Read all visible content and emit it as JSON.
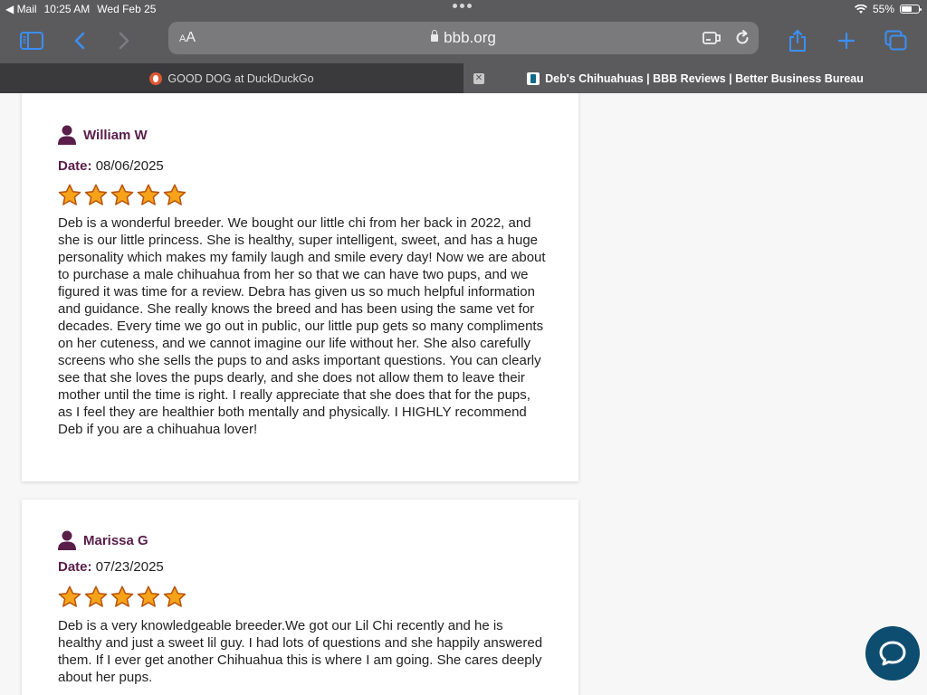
{
  "status_bar": {
    "back_app": "Mail",
    "time": "10:25 AM",
    "date": "Wed Feb 25",
    "battery": "55%",
    "battery_level": 0.55
  },
  "toolbar": {
    "text_size_label_small": "A",
    "text_size_label_large": "A",
    "url_domain": "bbb.org"
  },
  "tabs": [
    {
      "label": "GOOD DOG at DuckDuckGo",
      "active": false,
      "favicon": "duckduckgo-icon"
    },
    {
      "label": "Deb's Chihuahuas | BBB Reviews | Better Business Bureau",
      "active": true,
      "favicon": "bbb-icon"
    }
  ],
  "reviews": [
    {
      "name": "William W",
      "date_label": "Date:",
      "date": "08/06/2025",
      "rating": 5,
      "text": "Deb is a wonderful breeder. We bought our little chi from her back in 2022, and she is our little princess. She is healthy, super intelligent, sweet, and has a huge personality which makes my family laugh and smile every day! Now we are about to purchase a male chihuahua from her so that we can have two pups, and we figured it was time for a review. Debra has given us so much helpful information and guidance. She really knows the breed and has been using the same vet for decades. Every time we go out in public, our little pup gets so many compliments on her cuteness, and we cannot imagine our life without her. She also carefully screens who she sells the pups to and asks important questions. You can clearly see that she loves the pups dearly, and she does not allow them to leave their mother until the time is right. I really appreciate that she does that for the pups, as I feel they are healthier both mentally and physically. I HIGHLY recommend Deb if you are a chihuahua lover!"
    },
    {
      "name": "Marissa G",
      "date_label": "Date:",
      "date": "07/23/2025",
      "rating": 5,
      "text": "Deb is a very knowledgeable breeder.We got our Lil Chi recently and he is healthy and just a sweet lil guy. I had lots of questions and she happily answered them. If I ever get another Chihuahua this is where I am going. She cares deeply about her pups."
    }
  ],
  "colors": {
    "accent_name": "#5a1e4a",
    "star_fill": "#f6a31a",
    "star_stroke": "#b8520a",
    "chat_button": "#0d4d70",
    "safari_blue": "#3b8ff5"
  }
}
